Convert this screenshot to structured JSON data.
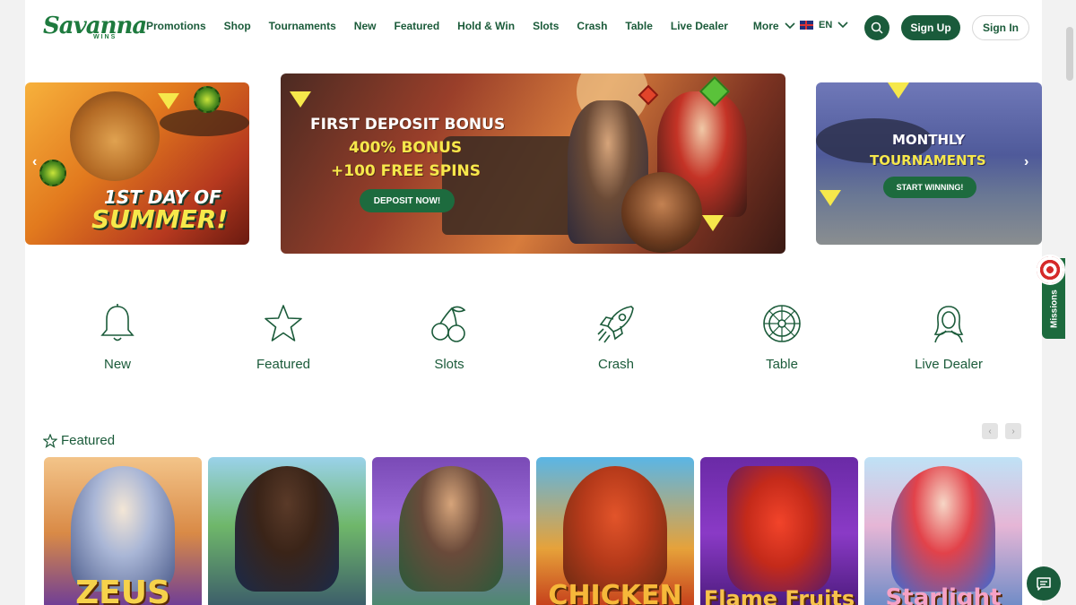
{
  "brand": {
    "name": "Savanna",
    "sub": "WINS"
  },
  "nav": {
    "items": [
      "Promotions",
      "Shop",
      "Tournaments",
      "New",
      "Featured",
      "Hold & Win",
      "Slots",
      "Crash",
      "Table",
      "Live Dealer"
    ],
    "more_label": "More"
  },
  "header": {
    "language": "EN",
    "signup_label": "Sign Up",
    "signin_label": "Sign In"
  },
  "banners": {
    "left": {
      "line1": "1ST DAY OF",
      "line2": "SUMMER!"
    },
    "center": {
      "title": "FIRST DEPOSIT BONUS",
      "line2": "400% BONUS",
      "line3": "+100 FREE SPINS",
      "button": "DEPOSIT NOW!"
    },
    "right": {
      "title": "MONTHLY",
      "sub": "TOURNAMENTS",
      "button": "START WINNING!"
    }
  },
  "categories": [
    {
      "label": "New",
      "icon": "bell-icon"
    },
    {
      "label": "Featured",
      "icon": "star-icon"
    },
    {
      "label": "Slots",
      "icon": "cherries-icon"
    },
    {
      "label": "Crash",
      "icon": "rocket-icon"
    },
    {
      "label": "Table",
      "icon": "roulette-icon"
    },
    {
      "label": "Live Dealer",
      "icon": "dealer-icon"
    }
  ],
  "featured": {
    "title": "Featured",
    "games": [
      {
        "title": "ZEUS"
      },
      {
        "title": ""
      },
      {
        "title": ""
      },
      {
        "title": "CHICKEN"
      },
      {
        "title": "Flame Fruits"
      },
      {
        "title": "Starlight"
      }
    ]
  },
  "missions": {
    "label": "Missions"
  },
  "colors": {
    "brand_green": "#1a5b3b",
    "accent_yellow": "#f6e84b",
    "text_green": "#1b5b3a"
  }
}
